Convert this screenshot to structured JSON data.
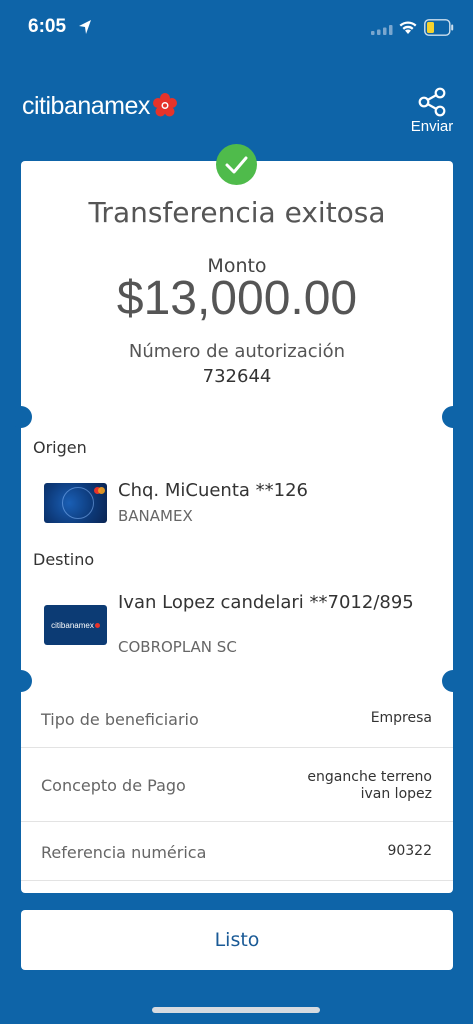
{
  "status_bar": {
    "time": "6:05"
  },
  "header": {
    "brand": "citibanamex",
    "share_label": "Enviar"
  },
  "receipt": {
    "title": "Transferencia exitosa",
    "amount_label": "Monto",
    "amount": "$13,000.00",
    "auth_label": "Número de autorización",
    "auth_number": "732644",
    "origin": {
      "section_label": "Origen",
      "account": "Chq. MiCuenta **126",
      "bank": "BANAMEX"
    },
    "destination": {
      "section_label": "Destino",
      "account": "Ivan Lopez candelari **7012/895",
      "bank": "COBROPLAN SC",
      "card_brand": "citibanamex"
    },
    "details": [
      {
        "label": "Tipo de beneficiario",
        "value_line1": "Empresa"
      },
      {
        "label": "Concepto de Pago",
        "value_line1": "enganche terreno",
        "value_line2": "ivan lopez"
      },
      {
        "label": "Referencia numérica",
        "value_line1": "90322"
      }
    ]
  },
  "actions": {
    "done_label": "Listo"
  },
  "colors": {
    "background": "#0e64a8",
    "success": "#4fbb4b",
    "brand_red": "#e6332a",
    "button_text": "#1a5a96"
  }
}
